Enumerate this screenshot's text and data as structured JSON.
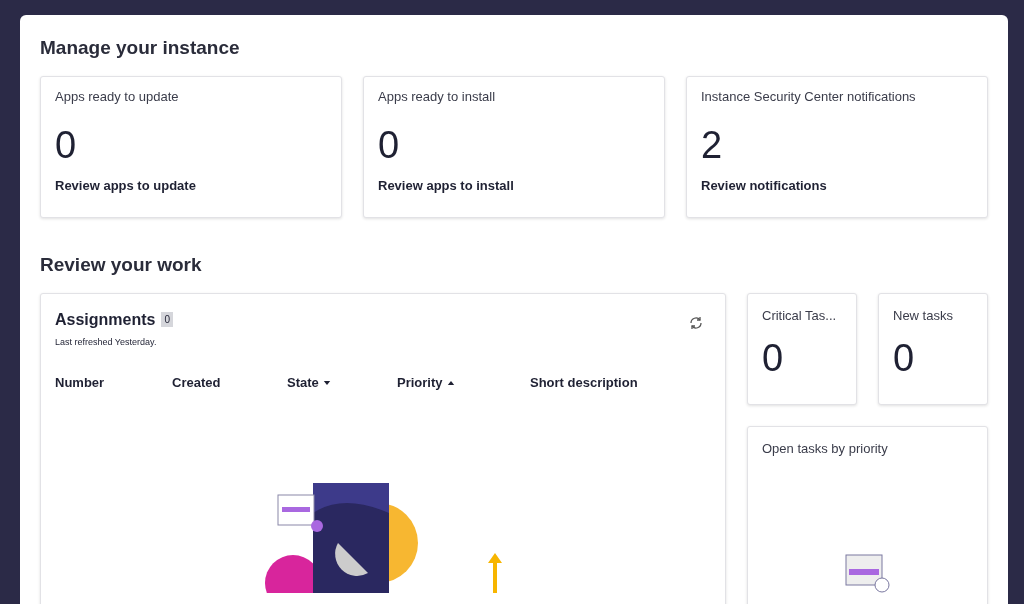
{
  "sections": [
    {
      "title": "Manage your instance"
    },
    {
      "title": "Review your work"
    }
  ],
  "instance_cards": [
    {
      "label": "Apps ready to update",
      "count": "0",
      "link": "Review apps to update"
    },
    {
      "label": "Apps ready to install",
      "count": "0",
      "link": "Review apps to install"
    },
    {
      "label": "Instance Security Center notifications",
      "count": "2",
      "link": "Review notifications"
    }
  ],
  "assignments": {
    "title": "Assignments",
    "count": "0",
    "refreshed": "Last refreshed Yesterday.",
    "columns": [
      {
        "label": "Number",
        "sorted": false
      },
      {
        "label": "Created",
        "sorted": false
      },
      {
        "label": "State",
        "sorted": true,
        "descending": true
      },
      {
        "label": "Priority",
        "sorted": true,
        "descending": false
      },
      {
        "label": "Short description",
        "sorted": false
      }
    ]
  },
  "task_cards": [
    {
      "label": "Critical Tas...",
      "count": "0"
    },
    {
      "label": "New tasks",
      "count": "0"
    }
  ],
  "priority_card": {
    "title": "Open tasks by priority"
  }
}
